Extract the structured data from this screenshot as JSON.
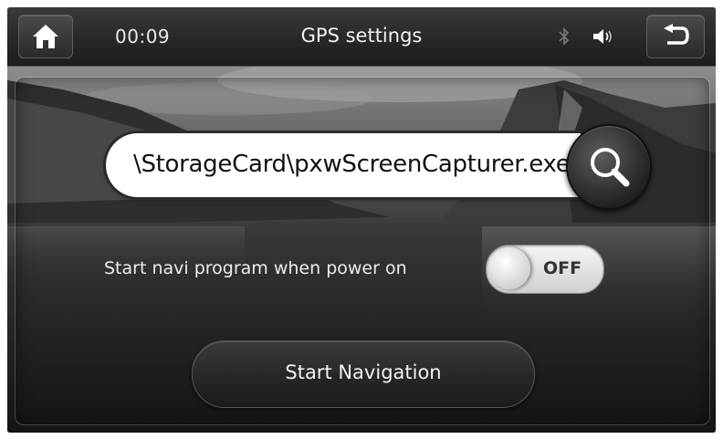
{
  "header": {
    "time": "00:09",
    "title": "GPS settings",
    "home_icon": "home-icon",
    "back_icon": "back-icon",
    "bluetooth_icon": "bluetooth-icon",
    "volume_icon": "volume-icon"
  },
  "navi_path": {
    "value": "\\StorageCard\\pxwScreenCapturer.exe",
    "search_icon": "search-icon"
  },
  "autostart": {
    "label": "Start navi program when power on",
    "state": "OFF"
  },
  "start_button": {
    "label": "Start Navigation"
  },
  "colors": {
    "bar_background": "#262626",
    "text": "#f2f2f2",
    "field_background": "#ffffff"
  }
}
